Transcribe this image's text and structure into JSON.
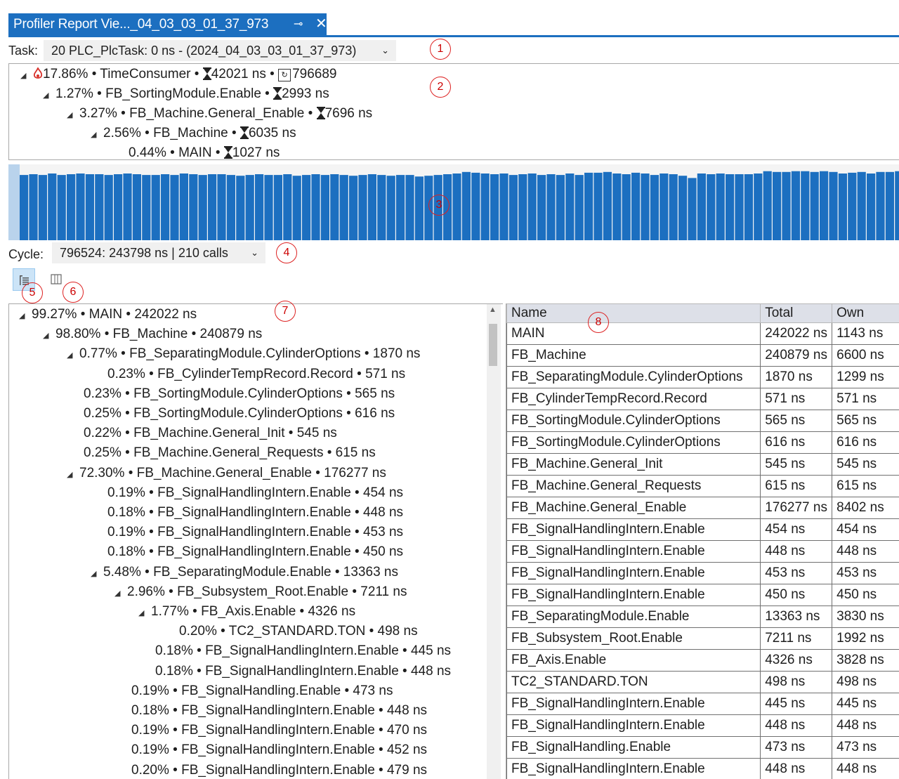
{
  "tab": {
    "title": "Profiler Report Vie..._04_03_03_01_37_973",
    "pin_glyph": "⊸",
    "close_glyph": "✕"
  },
  "task": {
    "label": "Task:",
    "value": "20 PLC_PlcTask: 0 ns - (2024_04_03_03_01_37_973)"
  },
  "hotpath": [
    {
      "text": "17.86% • TimeConsumer • ",
      "time": "42021 ns",
      "count": "796689",
      "flame": true,
      "level": 0
    },
    {
      "text": "1.27% • FB_SortingModule.Enable • ",
      "time": "2993 ns",
      "level": 1
    },
    {
      "text": "3.27% • FB_Machine.General_Enable • ",
      "time": "7696 ns",
      "level": 2
    },
    {
      "text": "2.56% • FB_Machine • ",
      "time": "6035 ns",
      "level": 3
    },
    {
      "text": "0.44% • MAIN • ",
      "time": "1027 ns",
      "level": 4,
      "leaf": true
    }
  ],
  "cycle_chart": {
    "bar_color": "#1c6fc0",
    "bar_heights_fraction": [
      0.86,
      0.87,
      0.86,
      0.88,
      0.86,
      0.87,
      0.88,
      0.87,
      0.87,
      0.86,
      0.87,
      0.88,
      0.87,
      0.86,
      0.86,
      0.87,
      0.86,
      0.88,
      0.87,
      0.86,
      0.87,
      0.87,
      0.86,
      0.85,
      0.86,
      0.87,
      0.86,
      0.86,
      0.87,
      0.85,
      0.86,
      0.87,
      0.86,
      0.87,
      0.86,
      0.85,
      0.86,
      0.87,
      0.86,
      0.85,
      0.86,
      0.86,
      0.84,
      0.85,
      0.86,
      0.87,
      0.88,
      0.9,
      0.89,
      0.88,
      0.87,
      0.88,
      0.86,
      0.87,
      0.88,
      0.86,
      0.87,
      0.86,
      0.88,
      0.86,
      0.89,
      0.89,
      0.9,
      0.88,
      0.87,
      0.89,
      0.88,
      0.86,
      0.88,
      0.87,
      0.85,
      0.82,
      0.88,
      0.87,
      0.88,
      0.87,
      0.87,
      0.87,
      0.88,
      0.91,
      0.9,
      0.9,
      0.91,
      0.91,
      0.9,
      0.91,
      0.9,
      0.88,
      0.89,
      0.9,
      0.88,
      0.9,
      0.9,
      0.91
    ]
  },
  "cycle": {
    "label": "Cycle:",
    "value": "796524: 243798 ns | 210 calls"
  },
  "callouts": [
    "1",
    "2",
    "3",
    "4",
    "5",
    "6",
    "7",
    "8"
  ],
  "tree": [
    {
      "text": "99.27% • MAIN • 242022 ns",
      "level": 0,
      "exp": true
    },
    {
      "text": "98.80% • FB_Machine • 240879 ns",
      "level": 1,
      "exp": true
    },
    {
      "text": "0.77% • FB_SeparatingModule.CylinderOptions • 1870 ns",
      "level": 2,
      "exp": true
    },
    {
      "text": "0.23% • FB_CylinderTempRecord.Record • 571 ns",
      "level": 3,
      "exp": false
    },
    {
      "text": "0.23% • FB_SortingModule.CylinderOptions • 565 ns",
      "level": 2,
      "exp": false
    },
    {
      "text": "0.25% • FB_SortingModule.CylinderOptions • 616 ns",
      "level": 2,
      "exp": false
    },
    {
      "text": "0.22% • FB_Machine.General_Init • 545 ns",
      "level": 2,
      "exp": false
    },
    {
      "text": "0.25% • FB_Machine.General_Requests • 615 ns",
      "level": 2,
      "exp": false
    },
    {
      "text": "72.30% • FB_Machine.General_Enable • 176277 ns",
      "level": 2,
      "exp": true
    },
    {
      "text": "0.19% • FB_SignalHandlingIntern.Enable • 454 ns",
      "level": 3,
      "exp": false
    },
    {
      "text": "0.18% • FB_SignalHandlingIntern.Enable • 448 ns",
      "level": 3,
      "exp": false
    },
    {
      "text": "0.19% • FB_SignalHandlingIntern.Enable • 453 ns",
      "level": 3,
      "exp": false
    },
    {
      "text": "0.18% • FB_SignalHandlingIntern.Enable • 450 ns",
      "level": 3,
      "exp": false
    },
    {
      "text": "5.48% • FB_SeparatingModule.Enable • 13363 ns",
      "level": 3,
      "exp": true
    },
    {
      "text": "2.96% • FB_Subsystem_Root.Enable • 7211 ns",
      "level": 4,
      "exp": true
    },
    {
      "text": "1.77% • FB_Axis.Enable • 4326 ns",
      "level": 5,
      "exp": true
    },
    {
      "text": "0.20% • TC2_STANDARD.TON • 498 ns",
      "level": 6,
      "exp": false
    },
    {
      "text": "0.18% • FB_SignalHandlingIntern.Enable • 445 ns",
      "level": 5,
      "exp": false
    },
    {
      "text": "0.18% • FB_SignalHandlingIntern.Enable • 448 ns",
      "level": 5,
      "exp": false
    },
    {
      "text": "0.19% • FB_SignalHandling.Enable • 473 ns",
      "level": 4,
      "exp": false
    },
    {
      "text": "0.18% • FB_SignalHandlingIntern.Enable • 448 ns",
      "level": 4,
      "exp": false
    },
    {
      "text": "0.19% • FB_SignalHandlingIntern.Enable • 470 ns",
      "level": 4,
      "exp": false
    },
    {
      "text": "0.19% • FB_SignalHandlingIntern.Enable • 452 ns",
      "level": 4,
      "exp": false
    },
    {
      "text": "0.20% • FB_SignalHandlingIntern.Enable • 479 ns",
      "level": 4,
      "exp": false
    }
  ],
  "table": {
    "headers": [
      "Name",
      "Total",
      "Own"
    ],
    "rows": [
      [
        "MAIN",
        "242022 ns",
        "1143 ns"
      ],
      [
        "FB_Machine",
        "240879 ns",
        "6600 ns"
      ],
      [
        "FB_SeparatingModule.CylinderOptions",
        "1870 ns",
        "1299 ns"
      ],
      [
        "FB_CylinderTempRecord.Record",
        "571 ns",
        "571 ns"
      ],
      [
        "FB_SortingModule.CylinderOptions",
        "565 ns",
        "565 ns"
      ],
      [
        "FB_SortingModule.CylinderOptions",
        "616 ns",
        "616 ns"
      ],
      [
        "FB_Machine.General_Init",
        "545 ns",
        "545 ns"
      ],
      [
        "FB_Machine.General_Requests",
        "615 ns",
        "615 ns"
      ],
      [
        "FB_Machine.General_Enable",
        "176277 ns",
        "8402 ns"
      ],
      [
        "FB_SignalHandlingIntern.Enable",
        "454 ns",
        "454 ns"
      ],
      [
        "FB_SignalHandlingIntern.Enable",
        "448 ns",
        "448 ns"
      ],
      [
        "FB_SignalHandlingIntern.Enable",
        "453 ns",
        "453 ns"
      ],
      [
        "FB_SignalHandlingIntern.Enable",
        "450 ns",
        "450 ns"
      ],
      [
        "FB_SeparatingModule.Enable",
        "13363 ns",
        "3830 ns"
      ],
      [
        "FB_Subsystem_Root.Enable",
        "7211 ns",
        "1992 ns"
      ],
      [
        "FB_Axis.Enable",
        "4326 ns",
        "3828 ns"
      ],
      [
        "TC2_STANDARD.TON",
        "498 ns",
        "498 ns"
      ],
      [
        "FB_SignalHandlingIntern.Enable",
        "445 ns",
        "445 ns"
      ],
      [
        "FB_SignalHandlingIntern.Enable",
        "448 ns",
        "448 ns"
      ],
      [
        "FB_SignalHandling.Enable",
        "473 ns",
        "473 ns"
      ],
      [
        "FB_SignalHandlingIntern.Enable",
        "448 ns",
        "448 ns"
      ]
    ]
  }
}
